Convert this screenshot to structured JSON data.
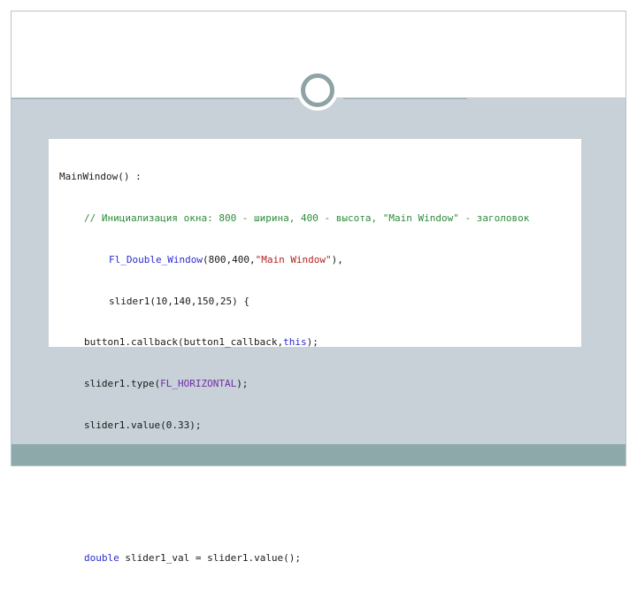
{
  "code": {
    "line1": "MainWindow() :",
    "line2_comment": "// Инициализация окна: 800 - ширина, 400 - высота, \"Main Window\" - заголовок",
    "line3_class": "Fl_Double_Window",
    "line3_args": "(800,400,",
    "line3_string": "\"Main Window\"",
    "line3_end": "),",
    "line4": "slider1(10,140,150,25) {",
    "line5_start": "button1.callback(button1_callback,",
    "line5_kw": "this",
    "line5_end": ");",
    "line6_start": "slider1.type(",
    "line6_const": "FL_HORIZONTAL",
    "line6_end": ");",
    "line7": "slider1.value(0.33);",
    "line8_kw": "double",
    "line8_rest": " slider1_val = slider1.value();"
  },
  "colors": {
    "band": "#c7d1d7",
    "footer": "#8ea9a9",
    "ring": "#8ea3a5",
    "comment": "#2e8b3a",
    "keyword": "#2b2bd1",
    "string": "#b22222"
  }
}
